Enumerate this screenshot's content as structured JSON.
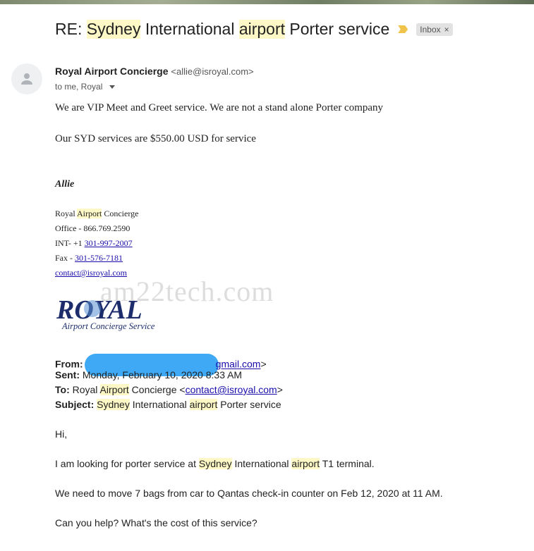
{
  "subject": {
    "prefix": "RE: ",
    "w1": "Sydney",
    "w2": " International ",
    "w3": "airport",
    "w4": " Porter service",
    "badge": "Inbox",
    "badge_close": "×"
  },
  "sender": {
    "name": "Royal Airport Concierge",
    "email": "<allie@isroyal.com>",
    "to_line": "to me, Royal"
  },
  "reply": {
    "line1": "We are VIP Meet and Greet service. We are not a stand alone Porter company",
    "line2": "Our SYD services are $550.00 USD for service"
  },
  "signature": {
    "name": "Allie",
    "company_a": "Royal ",
    "company_b": "Airport",
    "company_c": " Concierge",
    "office": "Office - 866.769.2590",
    "int_prefix": "INT- +1 ",
    "int_phone": "301-997-2007",
    "fax_prefix": "Fax - ",
    "fax": "301-576-7181",
    "email": "contact@isroyal.com"
  },
  "logo": {
    "word": "ROYAL",
    "tagline": "Airport Concierge Service"
  },
  "watermark": "am22tech.com",
  "forwarded": {
    "from_label": "From:",
    "from_tail": "gmail.com",
    "from_close": ">",
    "sent_label": "Sent:",
    "sent_value": " Monday, February 10, 2020 8:33 AM",
    "to_label": "To:",
    "to_a": " Royal ",
    "to_b": "Airport",
    "to_c": " Concierge <",
    "to_email": "contact@isroyal.com",
    "to_close": ">",
    "subject_label": "Subject:",
    "subj_a": "Sydney",
    "subj_b": " International ",
    "subj_c": "airport",
    "subj_d": " Porter service"
  },
  "original": {
    "greeting": "Hi,",
    "p1_a": "I am looking for porter service at ",
    "p1_b": "Sydney",
    "p1_c": " International ",
    "p1_d": "airport",
    "p1_e": " T1 terminal.",
    "p2": "We need to move 7 bags from car to Qantas check-in counter on Feb 12, 2020 at 11 AM.",
    "p3": "Can you help? What's the cost of this service?"
  },
  "colors": {
    "highlight": "#fdf8c6",
    "link": "#1a0dab",
    "redaction": "#3fa9f5",
    "logo_navy": "#1d2d6b"
  }
}
